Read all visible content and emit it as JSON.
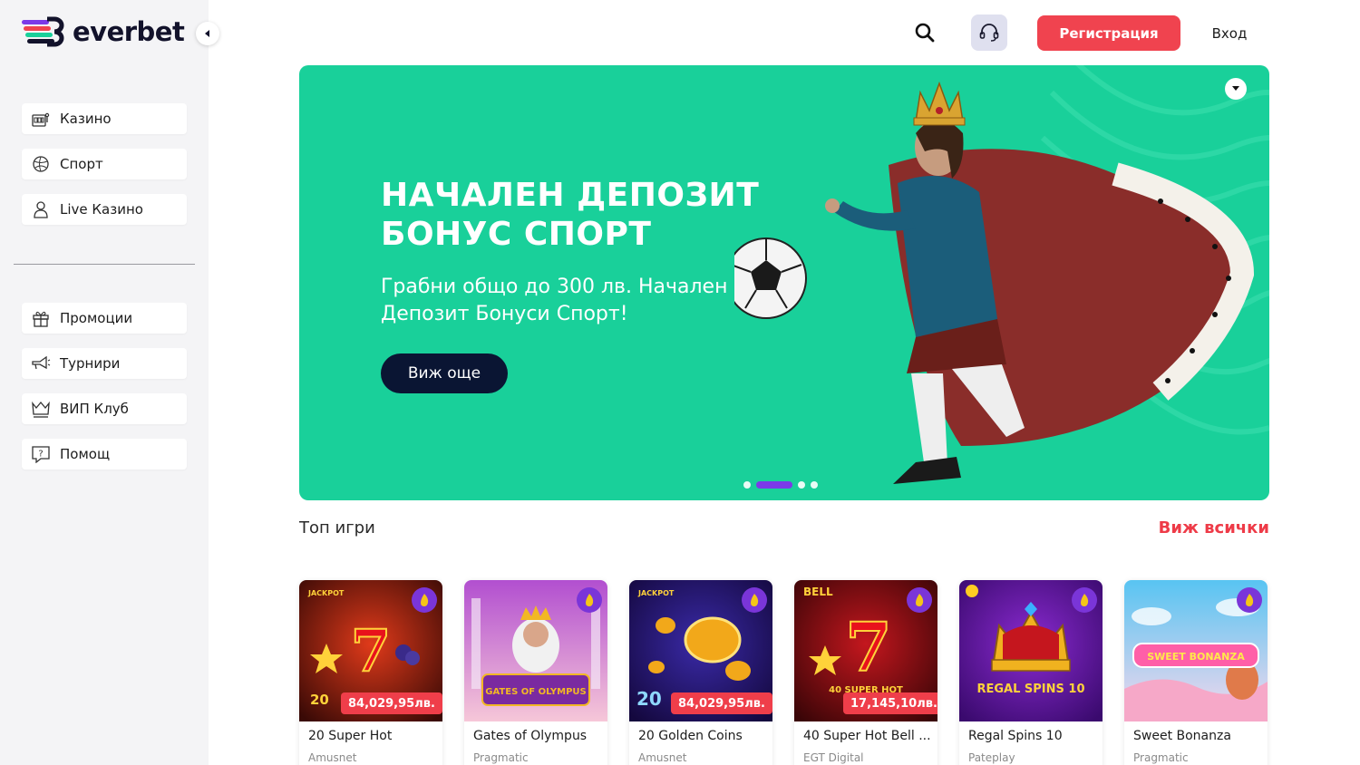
{
  "brand": {
    "name": "everbet"
  },
  "header": {
    "register_label": "Регистрация",
    "login_label": "Вход"
  },
  "sidebar": {
    "primary": [
      {
        "label": "Казино",
        "icon": "slot-machine-icon"
      },
      {
        "label": "Спорт",
        "icon": "ball-icon"
      },
      {
        "label": "Live Казино",
        "icon": "person-icon"
      }
    ],
    "secondary": [
      {
        "label": "Промоции",
        "icon": "gift-icon"
      },
      {
        "label": "Турнири",
        "icon": "megaphone-icon"
      },
      {
        "label": "ВИП Клуб",
        "icon": "crown-icon"
      },
      {
        "label": "Помощ",
        "icon": "help-icon"
      }
    ]
  },
  "banner": {
    "title": "НАЧАЛЕН ДЕПОЗИТ БОНУС СПОРТ",
    "subtitle": "Грабни общо до 300 лв. Начален Депозит Бонуси Спорт!",
    "cta_label": "Виж още",
    "slides": 4,
    "active_slide": 2
  },
  "top_games": {
    "title": "Топ игри",
    "view_all_label": "Виж всички",
    "games": [
      {
        "name": "20 Super Hot",
        "provider": "Amusnet",
        "jackpot": "84,029,95лв.",
        "thumb_label": "20"
      },
      {
        "name": "Gates of Olympus",
        "provider": "Pragmatic",
        "jackpot": "",
        "thumb_label": "GATES OF OLYMPUS"
      },
      {
        "name": "20 Golden Coins",
        "provider": "Amusnet",
        "jackpot": "84,029,95лв.",
        "thumb_label": "20"
      },
      {
        "name": "40 Super Hot Bell ...",
        "provider": "EGT Digital",
        "jackpot": "17,145,10лв.",
        "thumb_label": "40 SUPER HOT"
      },
      {
        "name": "Regal Spins 10",
        "provider": "Pateplay",
        "jackpot": "",
        "thumb_label": "REGAL SPINS 10"
      },
      {
        "name": "Sweet Bonanza",
        "provider": "Pragmatic",
        "jackpot": "",
        "thumb_label": "SWEET BONANZA"
      }
    ]
  },
  "colors": {
    "banner_bg": "#19d09a",
    "accent_red": "#f0434f",
    "accent_purple": "#7b3ae8",
    "cta_dark": "#0a1533"
  }
}
